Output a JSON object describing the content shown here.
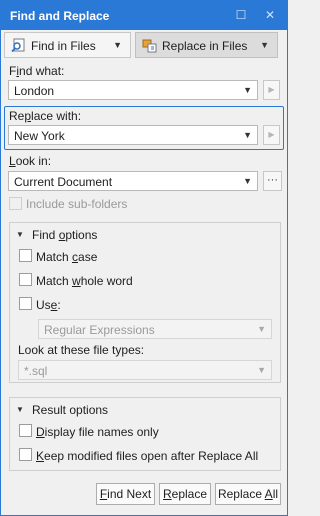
{
  "window": {
    "title": "Find and Replace",
    "restore_glyph": "☐",
    "close_glyph": "✕"
  },
  "tabs": [
    {
      "label": "Find in Files",
      "icon": "find-in-files-icon",
      "selected": false
    },
    {
      "label": "Replace in Files",
      "icon": "replace-in-files-icon",
      "selected": true
    }
  ],
  "find_what": {
    "label_pre": "F",
    "label_ul": "i",
    "label_post": "nd what:",
    "value": "London"
  },
  "replace_with": {
    "label_pre": "Re",
    "label_ul": "p",
    "label_post": "lace with:",
    "value": "New York"
  },
  "look_in": {
    "label_pre": "",
    "label_ul": "L",
    "label_post": "ook in:",
    "value": "Current Document",
    "browse_label": "···"
  },
  "include_subfolders": {
    "label": "Include sub-folders",
    "checked": false,
    "enabled": false
  },
  "find_options": {
    "header_pre": "Find ",
    "header_ul": "o",
    "header_post": "ptions",
    "match_case": {
      "pre": "Match ",
      "ul": "c",
      "post": "ase",
      "checked": false
    },
    "match_whole_word": {
      "pre": "Match ",
      "ul": "w",
      "post": "hole word",
      "checked": false
    },
    "use": {
      "pre": "Us",
      "ul": "e",
      "post": ":",
      "checked": false
    },
    "use_value": "Regular Expressions",
    "file_types_label": "Look at these file types:",
    "file_types_value": "*.sql"
  },
  "result_options": {
    "header": "Result options",
    "display_names": {
      "pre": "",
      "ul": "D",
      "post": "isplay file names only",
      "checked": false
    },
    "keep_open": {
      "pre": "",
      "ul": "K",
      "post": "eep modified files open after Replace All",
      "checked": false
    }
  },
  "buttons": {
    "find_next": {
      "pre": "",
      "ul": "F",
      "post": "ind Next"
    },
    "replace": {
      "pre": "",
      "ul": "R",
      "post": "eplace"
    },
    "replace_all": {
      "pre": "Replace ",
      "ul": "A",
      "post": "ll"
    }
  },
  "colors": {
    "accent": "#2b79d6",
    "background": "#f0f0f0"
  }
}
